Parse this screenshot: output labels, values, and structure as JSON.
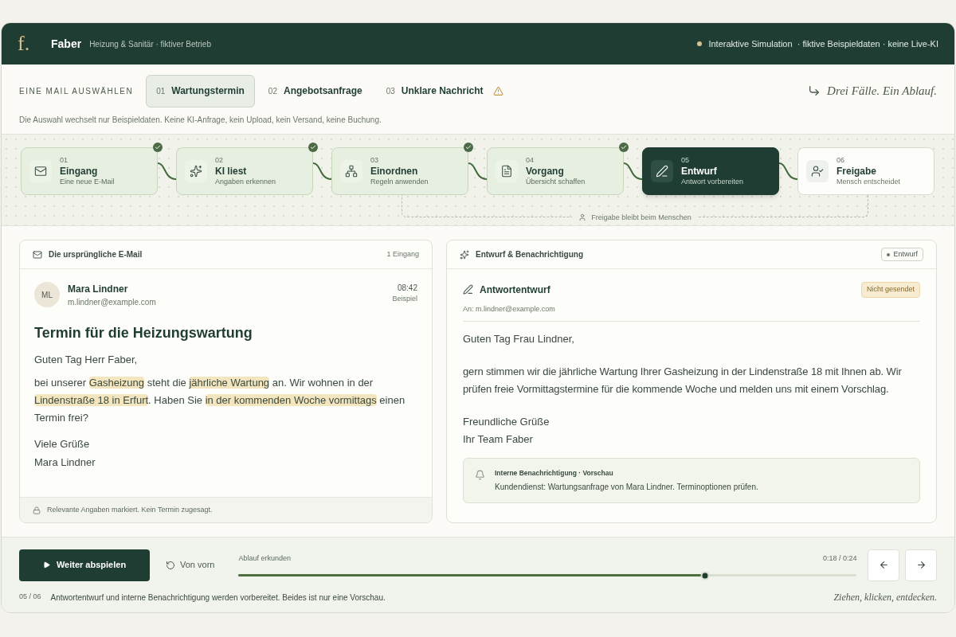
{
  "header": {
    "logo": "f.",
    "brand": "Faber",
    "tagline": "Heizung & Sanitär · fiktiver Betrieb",
    "status": "Interaktive Simulation  · fiktive Beispieldaten · keine Live-KI"
  },
  "selector": {
    "label": "EINE MAIL AUSWÄHLEN",
    "tabs": [
      {
        "number": "01",
        "label": "Wartungstermin",
        "selected": true,
        "warning": false
      },
      {
        "number": "02",
        "label": "Angebotsanfrage",
        "selected": false,
        "warning": false
      },
      {
        "number": "03",
        "label": "Unklare Nachricht",
        "selected": false,
        "warning": true
      }
    ],
    "note": "Die Auswahl wechselt nur Beispieldaten. Keine KI-Anfrage, kein Upload, kein Versand, keine Buchung.",
    "motto": "Drei Fälle. Ein Ablauf."
  },
  "pipeline": {
    "steps": [
      {
        "number": "01",
        "title": "Eingang",
        "subtitle": "Eine neue E-Mail",
        "done": true,
        "active": false,
        "kind": "mail"
      },
      {
        "number": "02",
        "title": "KI liest",
        "subtitle": "Angaben erkennen",
        "done": true,
        "active": false,
        "kind": "sparkle"
      },
      {
        "number": "03",
        "title": "Einordnen",
        "subtitle": "Regeln anwenden",
        "done": true,
        "active": false,
        "kind": "rules"
      },
      {
        "number": "04",
        "title": "Vorgang",
        "subtitle": "Übersicht schaffen",
        "done": true,
        "active": false,
        "kind": "document"
      },
      {
        "number": "05",
        "title": "Entwurf",
        "subtitle": "Antwort vorbereiten",
        "done": false,
        "active": true,
        "kind": "pen"
      },
      {
        "number": "06",
        "title": "Freigabe",
        "subtitle": "Mensch entscheidet",
        "done": false,
        "active": false,
        "kind": "person"
      }
    ],
    "approval_note": "Freigabe bleibt beim Menschen"
  },
  "email": {
    "title": "Die ursprüngliche E-Mail",
    "count": "1 Eingang",
    "sender": {
      "initials": "ML",
      "name": "Mara Lindner",
      "address": "m.lindner@example.com",
      "time": "08:42",
      "time_note": "Beispiel"
    },
    "subject": "Termin für die Heizungswartung",
    "greeting": "Guten Tag Herr Faber,",
    "body": [
      {
        "text": "bei unserer ",
        "highlight": false
      },
      {
        "text": "Gasheizung",
        "highlight": true
      },
      {
        "text": " steht die ",
        "highlight": false
      },
      {
        "text": "jährliche Wartung",
        "highlight": true
      },
      {
        "text": " an. Wir wohnen in der ",
        "highlight": false
      },
      {
        "text": "Lindenstraße 18 in Erfurt",
        "highlight": true
      },
      {
        "text": ". Haben Sie ",
        "highlight": false
      },
      {
        "text": "in der kommenden Woche vormittags",
        "highlight": true
      },
      {
        "text": " einen Termin frei?",
        "highlight": false
      }
    ],
    "closing": [
      "Viele Grüße",
      "Mara Lindner"
    ],
    "footer": "Relevante Angaben markiert. Kein Termin zugesagt."
  },
  "draft": {
    "title": "Entwurf & Benachrichtigung",
    "badge": "Entwurf",
    "heading": "Antwortentwurf",
    "status": "Nicht gesendet",
    "recipient": "An: m.lindner@example.com",
    "greeting": "Guten Tag Frau Lindner,",
    "body": "gern stimmen wir die jährliche Wartung Ihrer Gasheizung in der Lindenstraße 18 mit Ihnen ab. Wir prüfen freie Vormittagstermine für die kommende Woche und melden uns mit einem Vorschlag.",
    "closing": [
      "Freundliche Grüße",
      "Ihr Team Faber"
    ],
    "notification": {
      "title": "Interne Benachrichtigung · Vorschau",
      "text": "Kundendienst: Wartungsanfrage von Mara Lindner. Terminoptionen prüfen."
    }
  },
  "player": {
    "play_label": "Weiter abspielen",
    "restart_label": "Von vorn",
    "progress": {
      "label": "Ablauf erkunden",
      "time": "0:18 / 0:24",
      "level": 0.755
    },
    "step_counter": "05 / 06",
    "caption": "Antwortentwurf und interne Benachrichtigung werden vorbereitet. Beides ist nur eine Vorschau.",
    "tagline": "Ziehen, klicken, entdecken."
  }
}
